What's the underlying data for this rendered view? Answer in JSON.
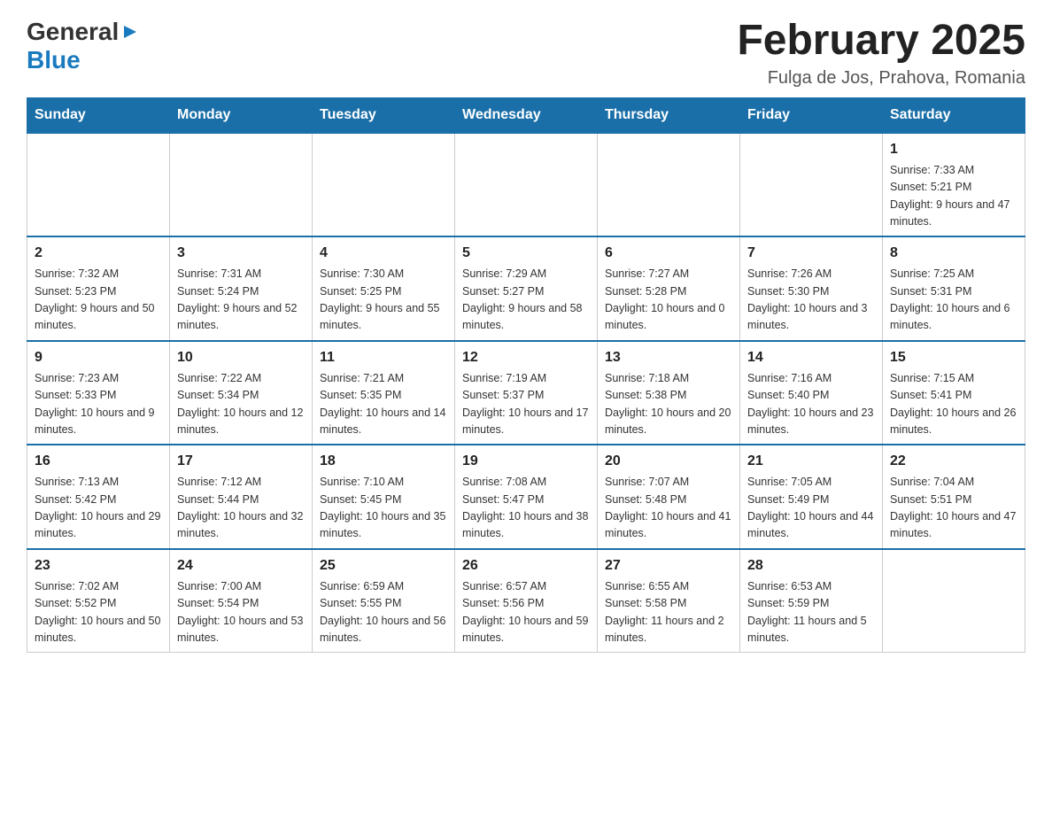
{
  "logo": {
    "general": "General",
    "blue": "Blue",
    "arrow": "▶"
  },
  "header": {
    "title": "February 2025",
    "location": "Fulga de Jos, Prahova, Romania"
  },
  "days_of_week": [
    "Sunday",
    "Monday",
    "Tuesday",
    "Wednesday",
    "Thursday",
    "Friday",
    "Saturday"
  ],
  "weeks": [
    {
      "cells": [
        {
          "day": "",
          "info": ""
        },
        {
          "day": "",
          "info": ""
        },
        {
          "day": "",
          "info": ""
        },
        {
          "day": "",
          "info": ""
        },
        {
          "day": "",
          "info": ""
        },
        {
          "day": "",
          "info": ""
        },
        {
          "day": "1",
          "info": "Sunrise: 7:33 AM\nSunset: 5:21 PM\nDaylight: 9 hours and 47 minutes."
        }
      ]
    },
    {
      "cells": [
        {
          "day": "2",
          "info": "Sunrise: 7:32 AM\nSunset: 5:23 PM\nDaylight: 9 hours and 50 minutes."
        },
        {
          "day": "3",
          "info": "Sunrise: 7:31 AM\nSunset: 5:24 PM\nDaylight: 9 hours and 52 minutes."
        },
        {
          "day": "4",
          "info": "Sunrise: 7:30 AM\nSunset: 5:25 PM\nDaylight: 9 hours and 55 minutes."
        },
        {
          "day": "5",
          "info": "Sunrise: 7:29 AM\nSunset: 5:27 PM\nDaylight: 9 hours and 58 minutes."
        },
        {
          "day": "6",
          "info": "Sunrise: 7:27 AM\nSunset: 5:28 PM\nDaylight: 10 hours and 0 minutes."
        },
        {
          "day": "7",
          "info": "Sunrise: 7:26 AM\nSunset: 5:30 PM\nDaylight: 10 hours and 3 minutes."
        },
        {
          "day": "8",
          "info": "Sunrise: 7:25 AM\nSunset: 5:31 PM\nDaylight: 10 hours and 6 minutes."
        }
      ]
    },
    {
      "cells": [
        {
          "day": "9",
          "info": "Sunrise: 7:23 AM\nSunset: 5:33 PM\nDaylight: 10 hours and 9 minutes."
        },
        {
          "day": "10",
          "info": "Sunrise: 7:22 AM\nSunset: 5:34 PM\nDaylight: 10 hours and 12 minutes."
        },
        {
          "day": "11",
          "info": "Sunrise: 7:21 AM\nSunset: 5:35 PM\nDaylight: 10 hours and 14 minutes."
        },
        {
          "day": "12",
          "info": "Sunrise: 7:19 AM\nSunset: 5:37 PM\nDaylight: 10 hours and 17 minutes."
        },
        {
          "day": "13",
          "info": "Sunrise: 7:18 AM\nSunset: 5:38 PM\nDaylight: 10 hours and 20 minutes."
        },
        {
          "day": "14",
          "info": "Sunrise: 7:16 AM\nSunset: 5:40 PM\nDaylight: 10 hours and 23 minutes."
        },
        {
          "day": "15",
          "info": "Sunrise: 7:15 AM\nSunset: 5:41 PM\nDaylight: 10 hours and 26 minutes."
        }
      ]
    },
    {
      "cells": [
        {
          "day": "16",
          "info": "Sunrise: 7:13 AM\nSunset: 5:42 PM\nDaylight: 10 hours and 29 minutes."
        },
        {
          "day": "17",
          "info": "Sunrise: 7:12 AM\nSunset: 5:44 PM\nDaylight: 10 hours and 32 minutes."
        },
        {
          "day": "18",
          "info": "Sunrise: 7:10 AM\nSunset: 5:45 PM\nDaylight: 10 hours and 35 minutes."
        },
        {
          "day": "19",
          "info": "Sunrise: 7:08 AM\nSunset: 5:47 PM\nDaylight: 10 hours and 38 minutes."
        },
        {
          "day": "20",
          "info": "Sunrise: 7:07 AM\nSunset: 5:48 PM\nDaylight: 10 hours and 41 minutes."
        },
        {
          "day": "21",
          "info": "Sunrise: 7:05 AM\nSunset: 5:49 PM\nDaylight: 10 hours and 44 minutes."
        },
        {
          "day": "22",
          "info": "Sunrise: 7:04 AM\nSunset: 5:51 PM\nDaylight: 10 hours and 47 minutes."
        }
      ]
    },
    {
      "cells": [
        {
          "day": "23",
          "info": "Sunrise: 7:02 AM\nSunset: 5:52 PM\nDaylight: 10 hours and 50 minutes."
        },
        {
          "day": "24",
          "info": "Sunrise: 7:00 AM\nSunset: 5:54 PM\nDaylight: 10 hours and 53 minutes."
        },
        {
          "day": "25",
          "info": "Sunrise: 6:59 AM\nSunset: 5:55 PM\nDaylight: 10 hours and 56 minutes."
        },
        {
          "day": "26",
          "info": "Sunrise: 6:57 AM\nSunset: 5:56 PM\nDaylight: 10 hours and 59 minutes."
        },
        {
          "day": "27",
          "info": "Sunrise: 6:55 AM\nSunset: 5:58 PM\nDaylight: 11 hours and 2 minutes."
        },
        {
          "day": "28",
          "info": "Sunrise: 6:53 AM\nSunset: 5:59 PM\nDaylight: 11 hours and 5 minutes."
        },
        {
          "day": "",
          "info": ""
        }
      ]
    }
  ]
}
